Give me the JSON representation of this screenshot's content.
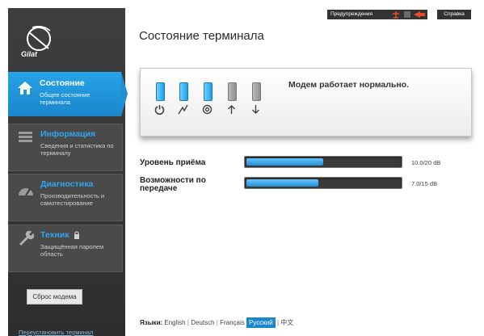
{
  "brand": {
    "logo_text": "Gilat"
  },
  "sidebar": {
    "items": [
      {
        "title": "Состояние",
        "desc": "Общее состояние терминала",
        "icon": "home-icon"
      },
      {
        "title": "Информация",
        "desc": "Сведения и статистика по терминалу",
        "icon": "list-icon"
      },
      {
        "title": "Диагностика",
        "desc": "Производительность и самотестирование",
        "icon": "gauge-icon"
      },
      {
        "title": "Техник",
        "desc": "Защищённая паролем область",
        "icon": "wrench-icon"
      }
    ],
    "reset_modem": "Сброс модема",
    "reinstall_terminal": "Переустановить терминал"
  },
  "topbar": {
    "warnings": "Предупреждения",
    "help": "Справка"
  },
  "page": {
    "title": "Состояние терминала"
  },
  "status": {
    "message": "Модем работает нормально.",
    "leds": [
      {
        "icon": "power-icon",
        "state": "on"
      },
      {
        "icon": "signal-icon",
        "state": "on"
      },
      {
        "icon": "at-icon",
        "state": "on"
      },
      {
        "icon": "upload-icon",
        "state": "off"
      },
      {
        "icon": "download-icon",
        "state": "off"
      }
    ]
  },
  "metrics": [
    {
      "label": "Уровень приёма",
      "value": "10.0/20 dB",
      "fraction": 0.5
    },
    {
      "label": "Возможности по передаче",
      "value": "7.0/15 dB",
      "fraction": 0.4667
    }
  ],
  "languages": {
    "label": "Языки:",
    "items": [
      "English",
      "Deutsch",
      "Français",
      "Русский",
      "中文"
    ],
    "selected": "Русский"
  },
  "colors": {
    "accent": "#1a86cc",
    "sidebar_bg": "#333333",
    "bar_fill": "#1f8fd8"
  }
}
